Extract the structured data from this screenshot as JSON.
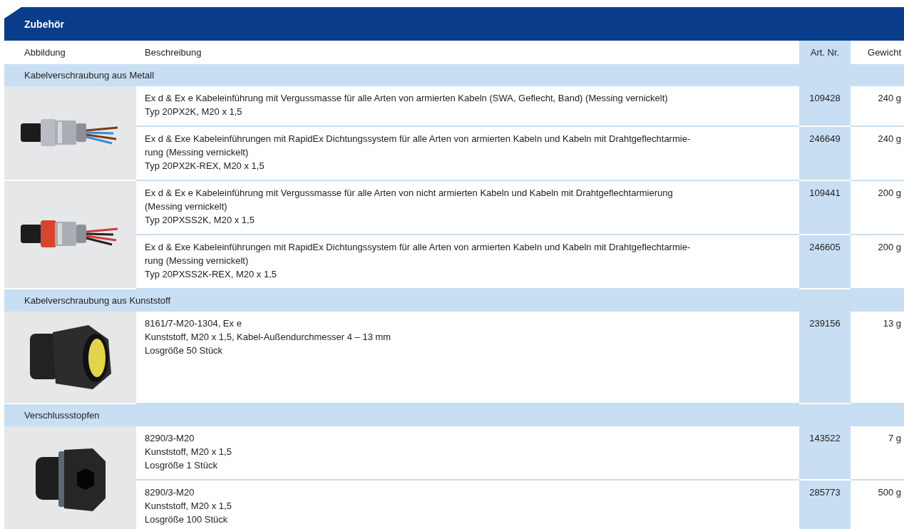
{
  "title": "Zubehör",
  "columns": [
    "Abbildung",
    "Beschreibung",
    "Art. Nr.",
    "Gewicht"
  ],
  "groups": [
    {
      "title": "Kabelverschraubung aus Metall",
      "products": [
        {
          "image": {
            "kind": "metal-gland"
          },
          "rows": [
            {
              "description": [
                "Ex d & Ex e Kabeleinführung mit Vergussmasse für alle Arten von armierten Kabeln (SWA, Geflecht, Band) (Messing vernickelt)",
                "Typ 20PX2K, M20 x 1,5"
              ],
              "art_nr": "109428",
              "weight": "240 g"
            },
            {
              "description": [
                "Ex d & Exe Kabeleinführungen mit RapidEx Dichtungssystem für alle Arten von armierten Kabeln und Kabeln mit Drahtgeflechtarmie-",
                "rung (Messing vernickelt)",
                "Typ 20PX2K-REX, M20 x 1,5"
              ],
              "art_nr": "246649",
              "weight": "240 g"
            }
          ]
        },
        {
          "image": {
            "kind": "metal-gland-red"
          },
          "rows": [
            {
              "description": [
                "Ex d & Ex e Kabeleinführung mit Vergussmasse für alle Arten von nicht armierten Kabeln und Kabeln mit Drahtgeflechtarmierung",
                "(Messing vernickelt)",
                "Typ 20PXSS2K, M20 x 1,5"
              ],
              "art_nr": "109441",
              "weight": "200 g"
            },
            {
              "description": [
                "Ex d & Exe Kabeleinführungen mit RapidEx Dichtungssystem für alle Arten von armierten Kabeln und Kabeln mit Drahtgeflechtarmie-",
                "rung (Messing vernickelt)",
                "Typ 20PXSS2K-REX, M20 x 1,5"
              ],
              "art_nr": "246605",
              "weight": "200 g"
            }
          ]
        }
      ]
    },
    {
      "title": "Kabelverschraubung aus Kunststoff",
      "products": [
        {
          "image": {
            "kind": "plastic-gland"
          },
          "rows": [
            {
              "description": [
                "8161/7-M20-1304, Ex e",
                "Kunststoff, M20 x 1,5, Kabel-Außendurchmesser 4 – 13 mm",
                "Losgröße 50 Stück"
              ],
              "art_nr": "239156",
              "weight": "13 g"
            }
          ]
        }
      ]
    },
    {
      "title": "Verschlussstopfen",
      "products": [
        {
          "image": {
            "kind": "plug"
          },
          "rows": [
            {
              "description": [
                "8290/3-M20",
                "Kunststoff, M20 x 1,5",
                "Losgröße 1 Stück"
              ],
              "art_nr": "143522",
              "weight": "7 g"
            },
            {
              "description": [
                "8290/3-M20",
                "Kunststoff, M20 x 1,5",
                "Losgröße 100 Stück"
              ],
              "art_nr": "285773",
              "weight": "500 g"
            }
          ]
        }
      ]
    }
  ]
}
